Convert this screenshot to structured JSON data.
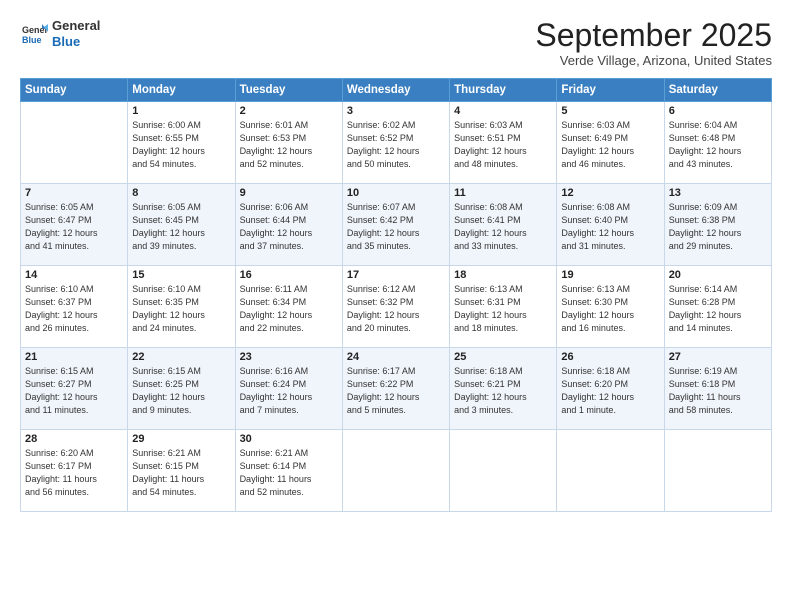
{
  "header": {
    "logo_line1": "General",
    "logo_line2": "Blue",
    "month": "September 2025",
    "location": "Verde Village, Arizona, United States"
  },
  "weekdays": [
    "Sunday",
    "Monday",
    "Tuesday",
    "Wednesday",
    "Thursday",
    "Friday",
    "Saturday"
  ],
  "weeks": [
    [
      {
        "day": "",
        "info": ""
      },
      {
        "day": "1",
        "info": "Sunrise: 6:00 AM\nSunset: 6:55 PM\nDaylight: 12 hours\nand 54 minutes."
      },
      {
        "day": "2",
        "info": "Sunrise: 6:01 AM\nSunset: 6:53 PM\nDaylight: 12 hours\nand 52 minutes."
      },
      {
        "day": "3",
        "info": "Sunrise: 6:02 AM\nSunset: 6:52 PM\nDaylight: 12 hours\nand 50 minutes."
      },
      {
        "day": "4",
        "info": "Sunrise: 6:03 AM\nSunset: 6:51 PM\nDaylight: 12 hours\nand 48 minutes."
      },
      {
        "day": "5",
        "info": "Sunrise: 6:03 AM\nSunset: 6:49 PM\nDaylight: 12 hours\nand 46 minutes."
      },
      {
        "day": "6",
        "info": "Sunrise: 6:04 AM\nSunset: 6:48 PM\nDaylight: 12 hours\nand 43 minutes."
      }
    ],
    [
      {
        "day": "7",
        "info": "Sunrise: 6:05 AM\nSunset: 6:47 PM\nDaylight: 12 hours\nand 41 minutes."
      },
      {
        "day": "8",
        "info": "Sunrise: 6:05 AM\nSunset: 6:45 PM\nDaylight: 12 hours\nand 39 minutes."
      },
      {
        "day": "9",
        "info": "Sunrise: 6:06 AM\nSunset: 6:44 PM\nDaylight: 12 hours\nand 37 minutes."
      },
      {
        "day": "10",
        "info": "Sunrise: 6:07 AM\nSunset: 6:42 PM\nDaylight: 12 hours\nand 35 minutes."
      },
      {
        "day": "11",
        "info": "Sunrise: 6:08 AM\nSunset: 6:41 PM\nDaylight: 12 hours\nand 33 minutes."
      },
      {
        "day": "12",
        "info": "Sunrise: 6:08 AM\nSunset: 6:40 PM\nDaylight: 12 hours\nand 31 minutes."
      },
      {
        "day": "13",
        "info": "Sunrise: 6:09 AM\nSunset: 6:38 PM\nDaylight: 12 hours\nand 29 minutes."
      }
    ],
    [
      {
        "day": "14",
        "info": "Sunrise: 6:10 AM\nSunset: 6:37 PM\nDaylight: 12 hours\nand 26 minutes."
      },
      {
        "day": "15",
        "info": "Sunrise: 6:10 AM\nSunset: 6:35 PM\nDaylight: 12 hours\nand 24 minutes."
      },
      {
        "day": "16",
        "info": "Sunrise: 6:11 AM\nSunset: 6:34 PM\nDaylight: 12 hours\nand 22 minutes."
      },
      {
        "day": "17",
        "info": "Sunrise: 6:12 AM\nSunset: 6:32 PM\nDaylight: 12 hours\nand 20 minutes."
      },
      {
        "day": "18",
        "info": "Sunrise: 6:13 AM\nSunset: 6:31 PM\nDaylight: 12 hours\nand 18 minutes."
      },
      {
        "day": "19",
        "info": "Sunrise: 6:13 AM\nSunset: 6:30 PM\nDaylight: 12 hours\nand 16 minutes."
      },
      {
        "day": "20",
        "info": "Sunrise: 6:14 AM\nSunset: 6:28 PM\nDaylight: 12 hours\nand 14 minutes."
      }
    ],
    [
      {
        "day": "21",
        "info": "Sunrise: 6:15 AM\nSunset: 6:27 PM\nDaylight: 12 hours\nand 11 minutes."
      },
      {
        "day": "22",
        "info": "Sunrise: 6:15 AM\nSunset: 6:25 PM\nDaylight: 12 hours\nand 9 minutes."
      },
      {
        "day": "23",
        "info": "Sunrise: 6:16 AM\nSunset: 6:24 PM\nDaylight: 12 hours\nand 7 minutes."
      },
      {
        "day": "24",
        "info": "Sunrise: 6:17 AM\nSunset: 6:22 PM\nDaylight: 12 hours\nand 5 minutes."
      },
      {
        "day": "25",
        "info": "Sunrise: 6:18 AM\nSunset: 6:21 PM\nDaylight: 12 hours\nand 3 minutes."
      },
      {
        "day": "26",
        "info": "Sunrise: 6:18 AM\nSunset: 6:20 PM\nDaylight: 12 hours\nand 1 minute."
      },
      {
        "day": "27",
        "info": "Sunrise: 6:19 AM\nSunset: 6:18 PM\nDaylight: 11 hours\nand 58 minutes."
      }
    ],
    [
      {
        "day": "28",
        "info": "Sunrise: 6:20 AM\nSunset: 6:17 PM\nDaylight: 11 hours\nand 56 minutes."
      },
      {
        "day": "29",
        "info": "Sunrise: 6:21 AM\nSunset: 6:15 PM\nDaylight: 11 hours\nand 54 minutes."
      },
      {
        "day": "30",
        "info": "Sunrise: 6:21 AM\nSunset: 6:14 PM\nDaylight: 11 hours\nand 52 minutes."
      },
      {
        "day": "",
        "info": ""
      },
      {
        "day": "",
        "info": ""
      },
      {
        "day": "",
        "info": ""
      },
      {
        "day": "",
        "info": ""
      }
    ]
  ]
}
